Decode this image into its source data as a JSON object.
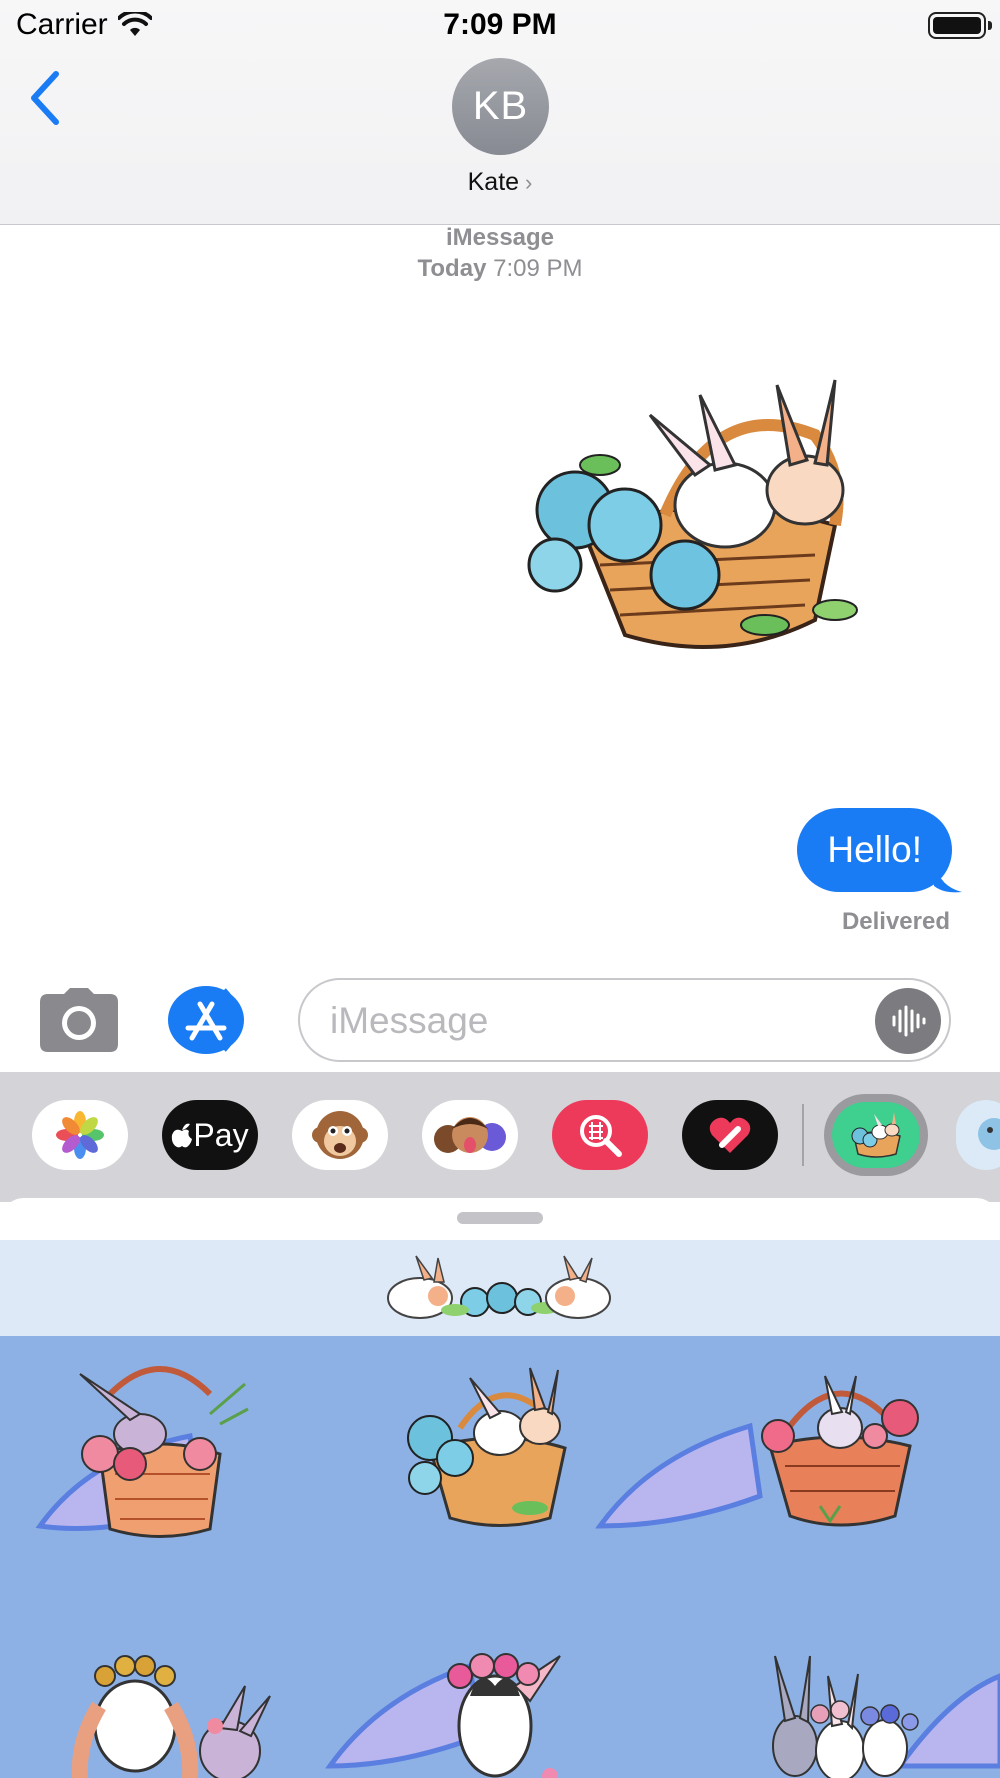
{
  "status_bar": {
    "carrier": "Carrier",
    "time": "7:09 PM"
  },
  "header": {
    "avatar_initials": "KB",
    "contact_name": "Kate",
    "chevron": "›"
  },
  "conversation": {
    "service": "iMessage",
    "timestamp_day": "Today",
    "timestamp_time": "7:09 PM",
    "messages": [
      {
        "type": "sticker",
        "sender": "me",
        "sticker": "bunnies-blue-roses-basket"
      },
      {
        "type": "text",
        "sender": "me",
        "text": "Hello!"
      }
    ],
    "status": "Delivered"
  },
  "composer": {
    "placeholder": "iMessage"
  },
  "app_drawer": {
    "apps": [
      {
        "name": "photos-icon"
      },
      {
        "name": "apple-pay-icon",
        "label": "Pay"
      },
      {
        "name": "animoji-icon"
      },
      {
        "name": "memoji-icon"
      },
      {
        "name": "image-search-icon"
      },
      {
        "name": "digital-touch-icon"
      },
      {
        "name": "easter-bunny-sticker-app-icon",
        "selected": true
      },
      {
        "name": "partial-app-icon"
      }
    ]
  },
  "sticker_panel": {
    "stickers": [
      "bunnies-pink-roses-basket",
      "bunnies-blue-roses-basket",
      "bunny-red-roses-basket",
      "lop-bunnies-flower-crown",
      "bunny-pink-flower-crown",
      "bunny-trio-flower-crowns"
    ]
  },
  "colors": {
    "accent": "#1a7cf5",
    "sticker_bg": "#8db1e5",
    "banner_bg": "#dde9f6",
    "drawer_bg": "#d3d3d8"
  }
}
